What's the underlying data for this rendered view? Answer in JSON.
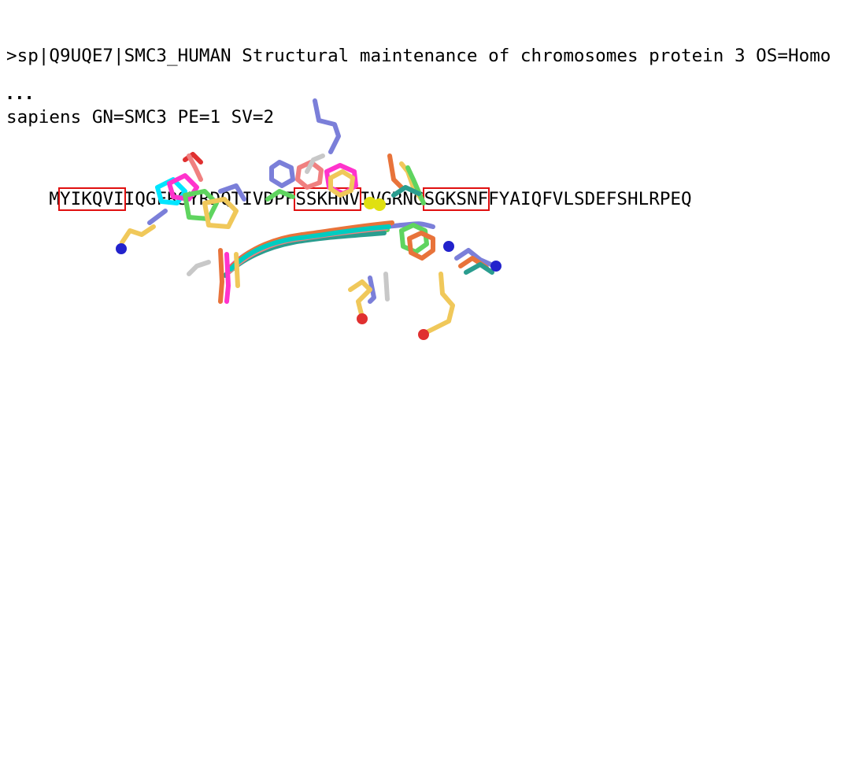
{
  "header": {
    "line1": ">sp|Q9UQE7|SMC3_HUMAN Structural maintenance of chromosomes protein 3 OS=Homo",
    "line2": "sapiens GN=SMC3 PE=1 SV=2",
    "sequence_segments": [
      {
        "text": "M",
        "highlighted": false
      },
      {
        "text": "YIKQVI",
        "highlighted": true
      },
      {
        "text": "IQGFRSYRDQTIVDPF",
        "highlighted": false
      },
      {
        "text": "SSKHNV",
        "highlighted": true
      },
      {
        "text": "IVGRNG",
        "highlighted": false
      },
      {
        "text": "SGKSNF",
        "highlighted": true
      },
      {
        "text": "FYAIQFVLSDEFSHLRPEQ",
        "highlighted": false
      }
    ],
    "highlight_color": "#e01010"
  },
  "ellipsis": "...",
  "structure": {
    "description_type": "superimposed peptide stick models",
    "colors": [
      "#7b7fd9",
      "#f0c85a",
      "#5fd45f",
      "#ff33cc",
      "#00ccc0",
      "#e8733a",
      "#2a9d8f",
      "#f08080",
      "#c8c8c8",
      "#e0e010",
      "#2222cc",
      "#e03030"
    ]
  }
}
